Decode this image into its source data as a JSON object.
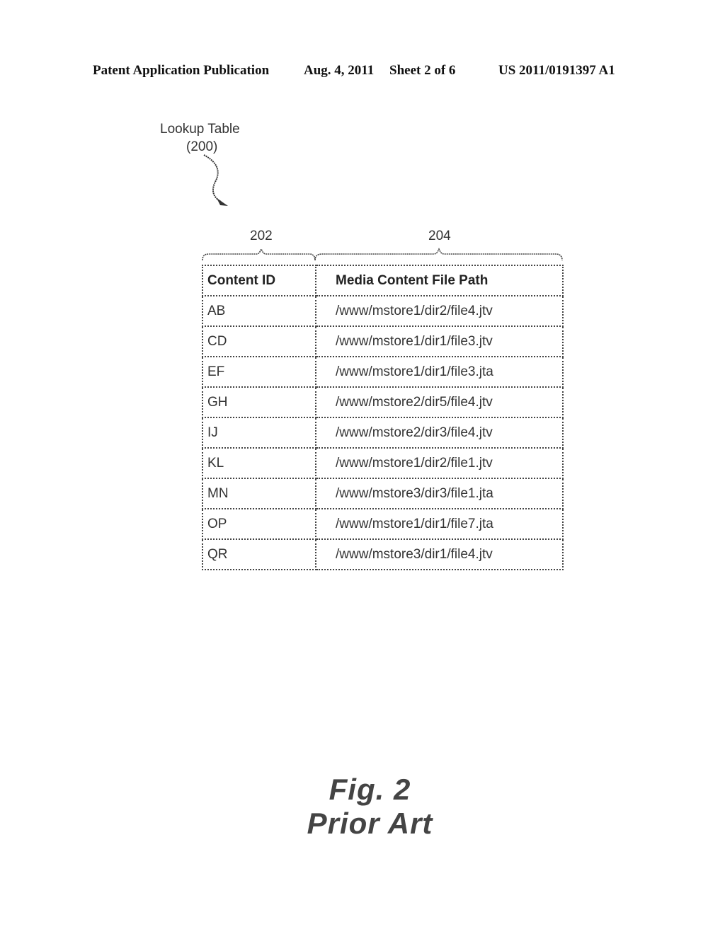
{
  "header": {
    "publication": "Patent Application Publication",
    "date": "Aug. 4, 2011",
    "sheet": "Sheet 2 of 6",
    "number": "US 2011/0191397 A1"
  },
  "figure_labels": {
    "lookup_table_title": "Lookup Table",
    "lookup_table_ref": "(200)",
    "column_ref_1": "202",
    "column_ref_2": "204"
  },
  "table": {
    "headers": [
      "Content ID",
      "Media Content File Path"
    ],
    "rows": [
      [
        "AB",
        "/www/mstore1/dir2/file4.jtv"
      ],
      [
        "CD",
        "/www/mstore1/dir1/file3.jtv"
      ],
      [
        "EF",
        "/www/mstore1/dir1/file3.jta"
      ],
      [
        "GH",
        "/www/mstore2/dir5/file4.jtv"
      ],
      [
        "IJ",
        "/www/mstore2/dir3/file4.jtv"
      ],
      [
        "KL",
        "/www/mstore1/dir2/file1.jtv"
      ],
      [
        "MN",
        "/www/mstore3/dir3/file1.jta"
      ],
      [
        "OP",
        "/www/mstore1/dir1/file7.jta"
      ],
      [
        "QR",
        "/www/mstore3/dir1/file4.jtv"
      ]
    ]
  },
  "caption": {
    "figure": "Fig. 2",
    "subtitle": "Prior Art"
  }
}
